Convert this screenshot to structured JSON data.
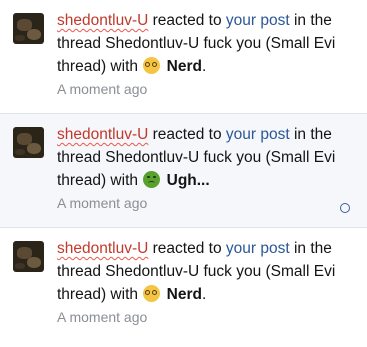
{
  "notifications": [
    {
      "user": "shedontluv-U",
      "reacted_text": " reacted to ",
      "post_link": "your post",
      "in_text": " in the thread ",
      "thread_title": "Shedontluv-U fuck you (Small Evi thread)",
      "with_text": " with ",
      "reaction_icon": "nerd-face-emoji",
      "reaction": "Nerd",
      "end_punct": ".",
      "time": "A moment ago"
    },
    {
      "user": "shedontluv-U",
      "reacted_text": " reacted to ",
      "post_link": "your post",
      "in_text": " in the thread ",
      "thread_title": "Shedontluv-U fuck you (Small Evi thread)",
      "with_text": " with ",
      "reaction_icon": "nauseated-face-emoji",
      "reaction": "Ugh...",
      "end_punct": "",
      "time": "A moment ago",
      "unread_icon": "circle-outline-icon"
    },
    {
      "user": "shedontluv-U",
      "reacted_text": " reacted to ",
      "post_link": "your post",
      "in_text": " in the thread ",
      "thread_title": "Shedontluv-U fuck you (Small Evi thread)",
      "with_text": " with ",
      "reaction_icon": "nerd-face-emoji",
      "reaction": "Nerd",
      "end_punct": ".",
      "time": "A moment ago"
    }
  ],
  "colors": {
    "username": "#c0392b",
    "link": "#2b5797",
    "timestamp": "#8a8f95",
    "highlight_row": "#f5f7fa",
    "divider": "#dfe3e8"
  }
}
